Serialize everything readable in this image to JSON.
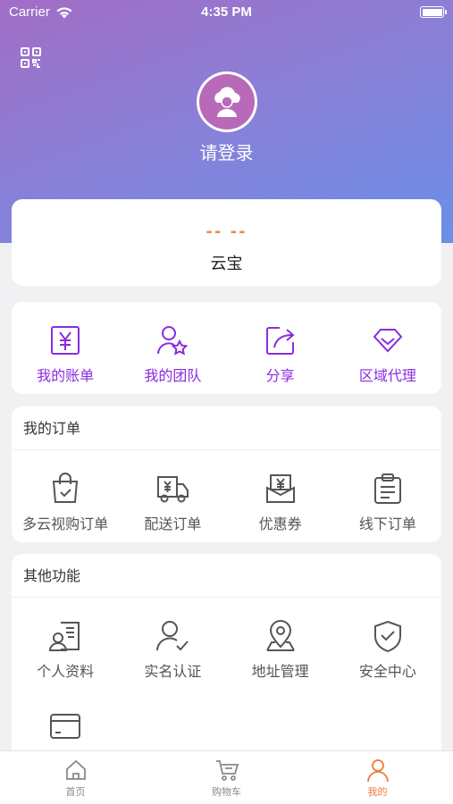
{
  "status_bar": {
    "carrier": "Carrier",
    "time": "4:35 PM"
  },
  "header": {
    "login_text": "请登录"
  },
  "yun_card": {
    "value": "-- --",
    "label": "云宝"
  },
  "quick_actions": [
    {
      "label": "我的账单",
      "icon": "bill-icon"
    },
    {
      "label": "我的团队",
      "icon": "team-icon"
    },
    {
      "label": "分享",
      "icon": "share-icon"
    },
    {
      "label": "区域代理",
      "icon": "diamond-icon"
    }
  ],
  "orders": {
    "title": "我的订单",
    "items": [
      {
        "label": "多云视购订单",
        "icon": "shopping-bag-icon"
      },
      {
        "label": "配送订单",
        "icon": "delivery-truck-icon"
      },
      {
        "label": "优惠券",
        "icon": "coupon-icon"
      },
      {
        "label": "线下订单",
        "icon": "clipboard-icon"
      }
    ]
  },
  "other": {
    "title": "其他功能",
    "items": [
      {
        "label": "个人资料",
        "icon": "profile-card-icon"
      },
      {
        "label": "实名认证",
        "icon": "verified-user-icon"
      },
      {
        "label": "地址管理",
        "icon": "location-pin-icon"
      },
      {
        "label": "安全中心",
        "icon": "shield-check-icon"
      },
      {
        "label": "",
        "icon": "bank-card-icon"
      }
    ]
  },
  "tabbar": [
    {
      "label": "首页",
      "icon": "home-icon",
      "active": false
    },
    {
      "label": "购物车",
      "icon": "cart-icon",
      "active": false
    },
    {
      "label": "我的",
      "icon": "user-icon",
      "active": true
    }
  ],
  "colors": {
    "accent_purple": "#8a2be2",
    "accent_orange": "#f07a3a",
    "icon_gray": "#555555"
  }
}
